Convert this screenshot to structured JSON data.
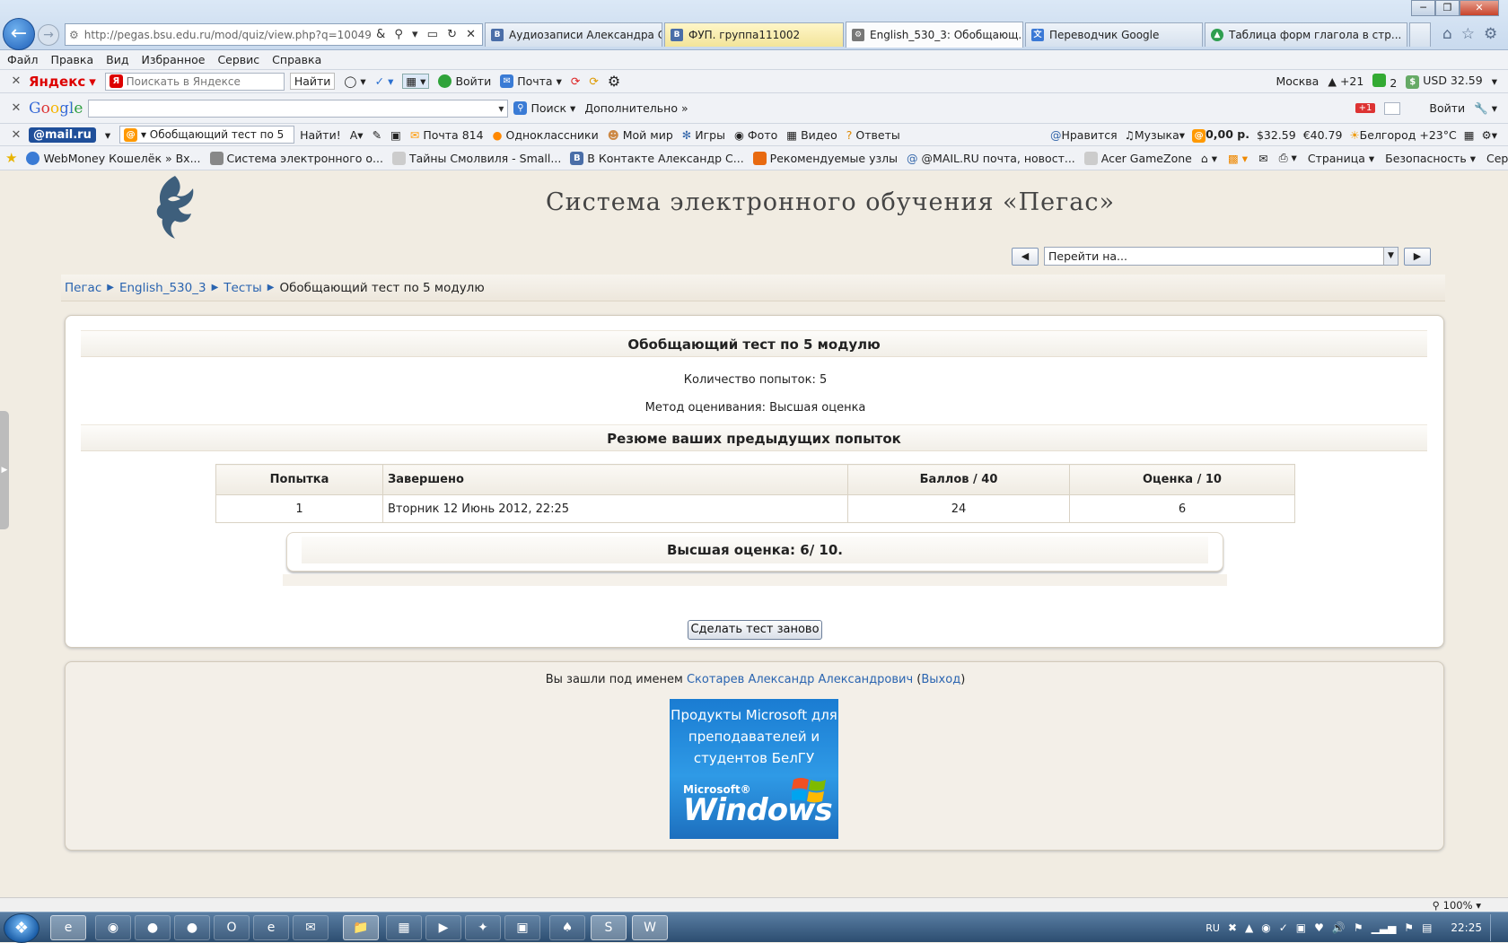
{
  "browser": {
    "address_url": "http://pegas.bsu.edu.ru/mod/quiz/view.php?q=10049",
    "tabs": [
      {
        "label": "Аудиозаписи Александра Ск...",
        "icon": "vk-icon"
      },
      {
        "label": "ФУП. группа111002",
        "icon": "vk-icon"
      },
      {
        "label": "English_530_3: Обобщающ...",
        "icon": "pegas-icon",
        "active": true
      },
      {
        "label": "Переводчик Google",
        "icon": "google-translate-icon"
      },
      {
        "label": "Таблица форм глагола в стр...",
        "icon": "google-drive-icon"
      }
    ],
    "menu": [
      "Файл",
      "Правка",
      "Вид",
      "Избранное",
      "Сервис",
      "Справка"
    ],
    "yandex_bar": {
      "logo": "Яндекс",
      "search_placeholder": "Поискать в Яндексе",
      "find": "Найти",
      "login": "Войти",
      "mail": "Почта",
      "city": "Москва",
      "temp": "+21",
      "count": "2",
      "usd": "USD 32.59"
    },
    "google_bar": {
      "logo": "Google",
      "search": "Поиск",
      "more": "Дополнительно »",
      "login": "Войти",
      "gplus": "+1"
    },
    "mail_bar": {
      "logo": "@mail.ru",
      "query": "Обобщающий тест по 5",
      "find": "Найти!",
      "mail": "Почта 814",
      "ok": "Одноклассники",
      "world": "Мой мир",
      "games": "Игры",
      "photo": "Фото",
      "video": "Видео",
      "answers": "Ответы",
      "like": "Нравится",
      "music": "Музыка",
      "money": "0,00 р.",
      "usd": "32.59",
      "eur": "40.79",
      "weather": "Белгород +23°С"
    },
    "favorites": [
      "WebMoney Кошелёк » Вх...",
      "Система электронного о...",
      "Тайны Смолвиля - Small...",
      "В Контакте  Александр С...",
      "Рекомендуемые узлы",
      "@MAIL.RU почта, новост...",
      "Acer GameZone"
    ],
    "command_bar": [
      "Страница",
      "Безопасность",
      "Сервис"
    ],
    "zoom": "100%"
  },
  "site": {
    "title": "Система электронного обучения «Пегас»",
    "jump_placeholder": "Перейти на..."
  },
  "breadcrumb": {
    "items": [
      "Пегас",
      "English_530_3",
      "Тесты"
    ],
    "current": "Обобщающий тест по 5 модулю"
  },
  "quiz": {
    "title": "Обобщающий тест по 5 модулю",
    "attempts_text": "Количество попыток: 5",
    "grading_text": "Метод оценивания: Высшая оценка",
    "summary_heading": "Резюме ваших предыдущих попыток",
    "table": {
      "headers": [
        "Попытка",
        "Завершено",
        "Баллов / 40",
        "Оценка / 10"
      ],
      "rows": [
        [
          "1",
          "Вторник 12 Июнь 2012, 22:25",
          "24",
          "6"
        ]
      ]
    },
    "best_grade": "Высшая оценка: 6/ 10.",
    "retake_button": "Сделать тест заново"
  },
  "footer": {
    "logged_in_prefix": "Вы зашли под именем",
    "user_name": "Скотарев Александр Александрович",
    "logout": "Выход",
    "banner_text": "Продукты Microsoft для преподавателей и студентов БелГУ",
    "banner_brand_small": "Microsoft®",
    "banner_brand": "Windows"
  },
  "taskbar": {
    "language": "RU",
    "clock": "22:25"
  }
}
